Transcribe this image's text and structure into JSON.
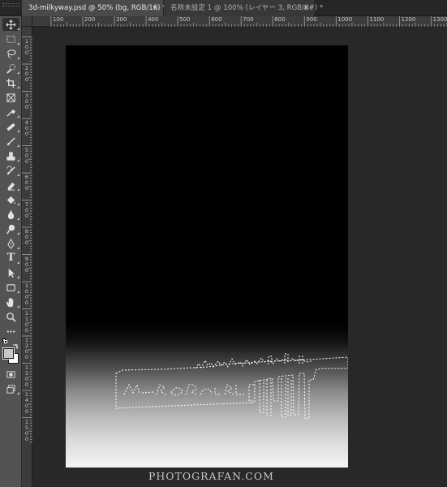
{
  "tabs": [
    {
      "label": "3d-milkyway.psd @ 50% (bg, RGB/16) *",
      "close": "×",
      "active": true
    },
    {
      "label": "名称未設定 1 @ 100% (レイヤー 3, RGB/8#) *",
      "close": "×",
      "active": false
    }
  ],
  "ruler": {
    "top": [
      "100",
      "200",
      "300",
      "400",
      "500",
      "600",
      "700",
      "800",
      "900",
      "1000",
      "1100",
      "1200",
      "1300"
    ],
    "left": [
      "100",
      "200",
      "300",
      "400",
      "500",
      "600",
      "700",
      "800",
      "900",
      "1000",
      "1100",
      "1200",
      "1300",
      "1400",
      "1500"
    ]
  },
  "tools": [
    "move-icon",
    "marquee-icon",
    "lasso-icon",
    "quick-selection-icon",
    "crop-icon",
    "frame-icon",
    "eyedropper-icon",
    "healing-brush-icon",
    "brush-icon",
    "clone-stamp-icon",
    "history-brush-icon",
    "eraser-icon",
    "paint-bucket-icon",
    "blur-icon",
    "dodge-icon",
    "pen-icon",
    "type-icon",
    "path-selection-icon",
    "rectangle-icon",
    "hand-icon",
    "zoom-icon",
    "more-tools-icon"
  ],
  "type_tool_glyph": "T",
  "colors": {
    "foreground": "#c8c8c8",
    "background": "#ffffff",
    "toolbar": "#535353",
    "workspace": "#282828"
  },
  "watermark": "PHOTOGRAFAN.COM"
}
